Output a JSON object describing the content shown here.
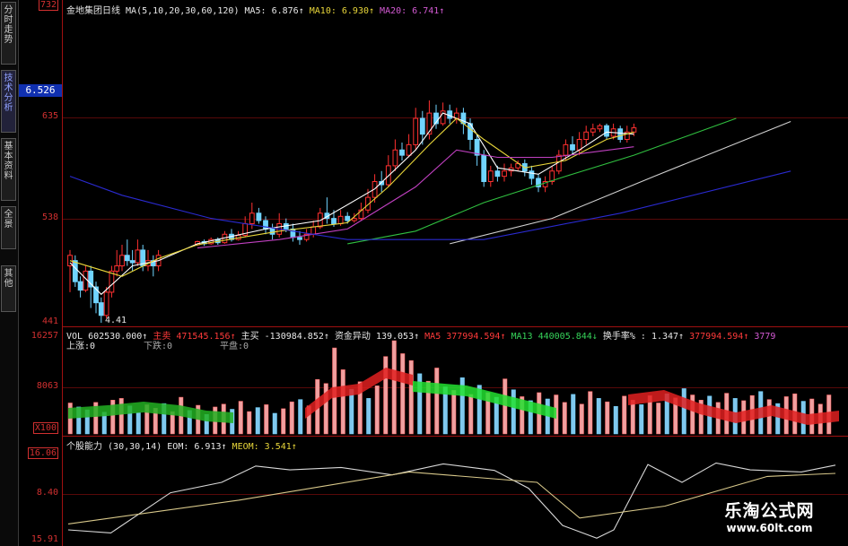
{
  "sidebar": {
    "tabs": [
      {
        "label": "分时走势"
      },
      {
        "label": "技术分析"
      },
      {
        "label": "基本资料"
      },
      {
        "label": "全景"
      },
      {
        "label": "其他"
      }
    ]
  },
  "price_panel": {
    "stock_name": "金地集团日线",
    "ma_header": "MA(5,10,20,30,60,120)",
    "ma5": "MA5: 6.876↑",
    "ma10": "MA10: 6.930↑",
    "ma20": "MA20: 6.741↑",
    "current_price": "6.526",
    "y_ticks": [
      "732",
      "635",
      "538",
      "441"
    ],
    "low_label": "4.41"
  },
  "volume_panel": {
    "vol": "VOL 602530.000↑",
    "main_sell": "主卖 471545.156↑",
    "main_buy": "主买 -130984.852↑",
    "capital_flow": "资金异动 139.053↑",
    "ma5": "MA5 377994.594↑",
    "ma13": "MA13 440005.844↓",
    "turnover": "换手率% : 1.347↑",
    "trail_1": "377994.594↑",
    "trail_2": "3779",
    "up_count": "上涨:0",
    "down_count": "下跌:0",
    "flat_count": "平盘:0",
    "y_ticks": [
      "16257",
      "8063",
      "X100"
    ]
  },
  "indicator_panel": {
    "name": "个股能力",
    "params": "(30,30,14)",
    "eom": "EOM: 6.913↑",
    "meom": "MEOM: 3.541↑",
    "y_ticks": [
      "16.06",
      "8.40",
      "15.91"
    ]
  },
  "watermark": {
    "title": "乐淘公式网",
    "url": "www.60lt.com"
  },
  "colors": {
    "up": "#ff3030",
    "down": "#70d4ff",
    "axis": "#a01010",
    "ma5": "#ffffff",
    "ma10": "#e8d63a",
    "ma20": "#c040c0",
    "ma30": "#30c040",
    "ma60": "#d0d0d0",
    "ma120": "#2a2ad0"
  },
  "chart_data": [
    {
      "type": "candlestick",
      "title": "金地集团日线",
      "ylim": [
        4.41,
        7.32
      ],
      "y_ticks": [
        7.32,
        6.35,
        5.38,
        4.41
      ],
      "candles": [
        [
          4.95,
          5.05,
          4.7,
          5.1
        ],
        [
          5.0,
          4.8,
          4.75,
          5.05
        ],
        [
          4.8,
          4.72,
          4.65,
          4.85
        ],
        [
          4.72,
          4.9,
          4.7,
          4.95
        ],
        [
          4.9,
          4.75,
          4.55,
          4.95
        ],
        [
          4.75,
          4.6,
          4.5,
          4.8
        ],
        [
          4.6,
          4.48,
          4.41,
          4.65
        ],
        [
          4.48,
          4.7,
          4.45,
          4.75
        ],
        [
          4.7,
          4.9,
          4.65,
          4.95
        ],
        [
          4.9,
          4.95,
          4.85,
          5.1
        ],
        [
          4.95,
          5.05,
          4.9,
          5.15
        ],
        [
          5.05,
          5.0,
          4.95,
          5.2
        ],
        [
          5.0,
          4.98,
          4.9,
          5.1
        ],
        [
          4.98,
          5.1,
          4.95,
          5.2
        ],
        [
          5.1,
          4.95,
          4.9,
          5.15
        ],
        [
          4.95,
          5.0,
          4.9,
          5.1
        ],
        [
          5.0,
          4.95,
          4.85,
          5.05
        ],
        [
          4.95,
          5.05,
          4.9,
          5.1
        ],
        [
          5.15,
          5.18,
          5.14,
          5.19
        ],
        [
          5.18,
          5.16,
          5.14,
          5.2
        ],
        [
          5.16,
          5.2,
          5.15,
          5.22
        ],
        [
          5.2,
          5.17,
          5.15,
          5.22
        ],
        [
          5.17,
          5.25,
          5.16,
          5.28
        ],
        [
          5.25,
          5.2,
          5.18,
          5.3
        ],
        [
          5.2,
          5.24,
          5.19,
          5.28
        ],
        [
          5.24,
          5.35,
          5.22,
          5.42
        ],
        [
          5.35,
          5.45,
          5.3,
          5.55
        ],
        [
          5.45,
          5.38,
          5.35,
          5.5
        ],
        [
          5.38,
          5.3,
          5.25,
          5.42
        ],
        [
          5.3,
          5.25,
          5.2,
          5.35
        ],
        [
          5.25,
          5.35,
          5.22,
          5.45
        ],
        [
          5.35,
          5.3,
          5.27,
          5.4
        ],
        [
          5.3,
          5.22,
          5.18,
          5.35
        ],
        [
          5.22,
          5.2,
          5.15,
          5.28
        ],
        [
          5.2,
          5.25,
          5.18,
          5.3
        ],
        [
          5.25,
          5.32,
          5.22,
          5.38
        ],
        [
          5.32,
          5.45,
          5.3,
          5.5
        ],
        [
          5.45,
          5.4,
          5.35,
          5.6
        ],
        [
          5.4,
          5.35,
          5.32,
          5.48
        ],
        [
          5.35,
          5.42,
          5.33,
          5.48
        ],
        [
          5.42,
          5.38,
          5.35,
          5.46
        ],
        [
          5.38,
          5.4,
          5.36,
          5.45
        ],
        [
          5.4,
          5.48,
          5.38,
          5.55
        ],
        [
          5.48,
          5.6,
          5.45,
          5.68
        ],
        [
          5.6,
          5.75,
          5.55,
          5.82
        ],
        [
          5.75,
          5.72,
          5.65,
          5.85
        ],
        [
          5.72,
          5.9,
          5.7,
          6.0
        ],
        [
          5.9,
          6.05,
          5.85,
          6.15
        ],
        [
          6.05,
          6.0,
          5.95,
          6.12
        ],
        [
          6.0,
          6.1,
          5.98,
          6.2
        ],
        [
          6.1,
          6.35,
          6.05,
          6.45
        ],
        [
          6.35,
          6.2,
          6.1,
          6.42
        ],
        [
          6.2,
          6.4,
          6.15,
          6.52
        ],
        [
          6.4,
          6.3,
          6.25,
          6.48
        ],
        [
          6.3,
          6.42,
          6.28,
          6.5
        ],
        [
          6.42,
          6.35,
          6.3,
          6.48
        ],
        [
          6.35,
          6.4,
          6.3,
          6.45
        ],
        [
          6.4,
          6.3,
          6.2,
          6.45
        ],
        [
          6.3,
          6.15,
          6.05,
          6.35
        ],
        [
          6.15,
          6.0,
          5.9,
          6.2
        ],
        [
          6.0,
          5.75,
          5.7,
          6.05
        ],
        [
          5.75,
          5.85,
          5.7,
          5.9
        ],
        [
          5.85,
          5.8,
          5.75,
          5.9
        ],
        [
          5.8,
          5.85,
          5.75,
          5.92
        ],
        [
          5.85,
          5.88,
          5.8,
          5.92
        ],
        [
          5.88,
          5.92,
          5.85,
          5.95
        ],
        [
          5.92,
          5.85,
          5.8,
          5.96
        ],
        [
          5.85,
          5.78,
          5.72,
          5.9
        ],
        [
          5.78,
          5.7,
          5.65,
          5.82
        ],
        [
          5.7,
          5.75,
          5.65,
          5.8
        ],
        [
          5.75,
          5.85,
          5.72,
          5.9
        ],
        [
          5.85,
          6.0,
          5.82,
          6.05
        ],
        [
          6.0,
          6.1,
          5.95,
          6.15
        ],
        [
          6.1,
          6.05,
          6.0,
          6.18
        ],
        [
          6.05,
          6.15,
          6.0,
          6.22
        ],
        [
          6.15,
          6.22,
          6.1,
          6.28
        ],
        [
          6.22,
          6.25,
          6.18,
          6.3
        ],
        [
          6.25,
          6.28,
          6.22,
          6.3
        ],
        [
          6.28,
          6.18,
          6.15,
          6.3
        ],
        [
          6.18,
          6.25,
          6.15,
          6.3
        ],
        [
          6.25,
          6.15,
          6.12,
          6.28
        ],
        [
          6.15,
          6.22,
          6.12,
          6.28
        ],
        [
          6.22,
          6.26,
          6.18,
          6.3
        ]
      ],
      "series": [
        {
          "name": "MA5",
          "values": [
            [
              0,
              4.98
            ],
            [
              6,
              4.68
            ],
            [
              12,
              4.95
            ],
            [
              17,
              5.0
            ],
            [
              18,
              5.16
            ],
            [
              28,
              5.3
            ],
            [
              36,
              5.38
            ],
            [
              44,
              5.68
            ],
            [
              50,
              6.05
            ],
            [
              54,
              6.4
            ],
            [
              58,
              6.3
            ],
            [
              62,
              5.88
            ],
            [
              68,
              5.82
            ],
            [
              74,
              6.05
            ],
            [
              78,
              6.22
            ],
            [
              82,
              6.2
            ]
          ]
        },
        {
          "name": "MA10",
          "values": [
            [
              0,
              5.0
            ],
            [
              10,
              4.85
            ],
            [
              17,
              5.02
            ],
            [
              18,
              5.15
            ],
            [
              30,
              5.28
            ],
            [
              40,
              5.36
            ],
            [
              46,
              5.7
            ],
            [
              52,
              6.1
            ],
            [
              56,
              6.35
            ],
            [
              60,
              6.15
            ],
            [
              66,
              5.88
            ],
            [
              72,
              5.95
            ],
            [
              78,
              6.15
            ],
            [
              82,
              6.22
            ]
          ]
        },
        {
          "name": "MA20",
          "values": [
            [
              18,
              5.12
            ],
            [
              30,
              5.2
            ],
            [
              40,
              5.3
            ],
            [
              50,
              5.7
            ],
            [
              56,
              6.05
            ],
            [
              62,
              5.98
            ],
            [
              70,
              5.98
            ],
            [
              82,
              6.08
            ]
          ]
        },
        {
          "name": "MA30",
          "values": [
            [
              40,
              5.16
            ],
            [
              50,
              5.28
            ],
            [
              60,
              5.55
            ],
            [
              72,
              5.8
            ],
            [
              82,
              6.0
            ],
            [
              97,
              6.35
            ]
          ]
        },
        {
          "name": "MA60",
          "values": [
            [
              55,
              5.16
            ],
            [
              70,
              5.4
            ],
            [
              85,
              5.8
            ],
            [
              105,
              6.32
            ]
          ]
        },
        {
          "name": "MA120",
          "values": [
            [
              0,
              5.8
            ],
            [
              10,
              5.62
            ],
            [
              20,
              5.4
            ],
            [
              40,
              5.2
            ],
            [
              60,
              5.2
            ],
            [
              80,
              5.45
            ],
            [
              105,
              5.85
            ]
          ]
        }
      ]
    },
    {
      "type": "bar",
      "title": "VOL",
      "ylim": [
        0,
        16257
      ],
      "y_ticks": [
        16257,
        8063
      ],
      "bars": [
        [
          5400,
          0
        ],
        [
          4700,
          1
        ],
        [
          4200,
          1
        ],
        [
          5500,
          0
        ],
        [
          3800,
          1
        ],
        [
          5900,
          0
        ],
        [
          6200,
          0
        ],
        [
          4900,
          1
        ],
        [
          3700,
          1
        ],
        [
          5100,
          0
        ],
        [
          4500,
          0
        ],
        [
          5300,
          1
        ],
        [
          3900,
          0
        ],
        [
          6400,
          0
        ],
        [
          4100,
          1
        ],
        [
          5000,
          0
        ],
        [
          3400,
          1
        ],
        [
          4700,
          0
        ],
        [
          5200,
          0
        ],
        [
          4300,
          1
        ],
        [
          5700,
          0
        ],
        [
          3900,
          0
        ],
        [
          4600,
          1
        ],
        [
          5100,
          0
        ],
        [
          3600,
          1
        ],
        [
          4400,
          0
        ],
        [
          5600,
          0
        ],
        [
          6000,
          1
        ],
        [
          4900,
          0
        ],
        [
          9500,
          0
        ],
        [
          8800,
          0
        ],
        [
          15000,
          0
        ],
        [
          11200,
          0
        ],
        [
          7800,
          1
        ],
        [
          9100,
          0
        ],
        [
          6200,
          1
        ],
        [
          8400,
          0
        ],
        [
          13500,
          0
        ],
        [
          16257,
          0
        ],
        [
          14000,
          0
        ],
        [
          12800,
          0
        ],
        [
          10500,
          1
        ],
        [
          9200,
          0
        ],
        [
          11500,
          0
        ],
        [
          8200,
          1
        ],
        [
          7600,
          0
        ],
        [
          9800,
          1
        ],
        [
          6900,
          0
        ],
        [
          8500,
          1
        ],
        [
          7200,
          0
        ],
        [
          6400,
          1
        ],
        [
          9600,
          0
        ],
        [
          7700,
          1
        ],
        [
          6500,
          0
        ],
        [
          5800,
          1
        ],
        [
          7200,
          0
        ],
        [
          6100,
          1
        ],
        [
          6800,
          0
        ],
        [
          5500,
          0
        ],
        [
          6900,
          1
        ],
        [
          5200,
          0
        ],
        [
          7400,
          0
        ],
        [
          6200,
          1
        ],
        [
          5600,
          0
        ],
        [
          4800,
          1
        ],
        [
          6600,
          0
        ],
        [
          5900,
          0
        ],
        [
          5100,
          1
        ],
        [
          6700,
          0
        ],
        [
          5400,
          0
        ],
        [
          7000,
          1
        ],
        [
          6300,
          0
        ],
        [
          7900,
          1
        ],
        [
          6800,
          0
        ],
        [
          5900,
          0
        ],
        [
          6600,
          1
        ],
        [
          5500,
          0
        ],
        [
          7100,
          0
        ],
        [
          6200,
          1
        ],
        [
          5800,
          0
        ],
        [
          6700,
          0
        ],
        [
          7400,
          1
        ],
        [
          6000,
          0
        ],
        [
          5300,
          1
        ],
        [
          6500,
          0
        ],
        [
          7000,
          0
        ],
        [
          5700,
          1
        ],
        [
          6100,
          0
        ],
        [
          5200,
          0
        ],
        [
          6800,
          0
        ]
      ]
    },
    {
      "type": "line",
      "title": "个股能力",
      "ylim": [
        -15.91,
        16.06
      ],
      "y_ticks": [
        16.06,
        8.4,
        -15.91
      ],
      "series": [
        {
          "name": "EOM",
          "values": [
            [
              0,
              -12.0
            ],
            [
              5,
              -13.0
            ],
            [
              12,
              0.5
            ],
            [
              18,
              4.0
            ],
            [
              22,
              9.5
            ],
            [
              26,
              8.2
            ],
            [
              32,
              9.0
            ],
            [
              38,
              6.5
            ],
            [
              44,
              10.2
            ],
            [
              50,
              8.0
            ],
            [
              54,
              2.0
            ],
            [
              58,
              -10.5
            ],
            [
              62,
              -14.8
            ],
            [
              64,
              -12.0
            ],
            [
              68,
              10.0
            ],
            [
              72,
              4.0
            ],
            [
              76,
              10.5
            ],
            [
              80,
              8.2
            ],
            [
              86,
              7.5
            ],
            [
              90,
              9.8
            ]
          ]
        },
        {
          "name": "MEOM",
          "values": [
            [
              0,
              -10.0
            ],
            [
              20,
              -2.0
            ],
            [
              40,
              7.5
            ],
            [
              55,
              4.0
            ],
            [
              60,
              -8.0
            ],
            [
              70,
              -4.0
            ],
            [
              82,
              6.0
            ],
            [
              90,
              7.0
            ]
          ]
        }
      ]
    }
  ]
}
